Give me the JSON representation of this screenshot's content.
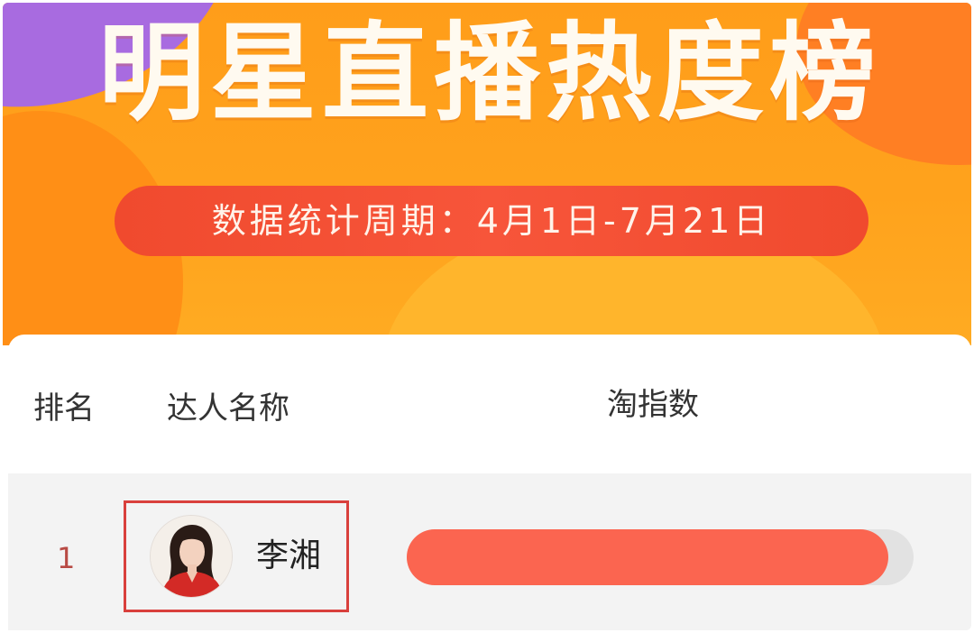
{
  "banner": {
    "title": "明星直播热度榜",
    "period_text": "数据统计周期：4月1日-7月21日"
  },
  "table": {
    "headers": {
      "rank": "排名",
      "name": "达人名称",
      "index": "淘指数"
    },
    "rows": [
      {
        "rank": "1",
        "name": "李湘",
        "index_fraction": 0.95
      }
    ]
  },
  "colors": {
    "banner_orange": "#ff9d1a",
    "pill_red": "#f04a2e",
    "bar_fill": "#fb6550",
    "bar_track": "#e2e2e2",
    "highlight_border": "#d9403c",
    "rank_color": "#b84a44"
  }
}
